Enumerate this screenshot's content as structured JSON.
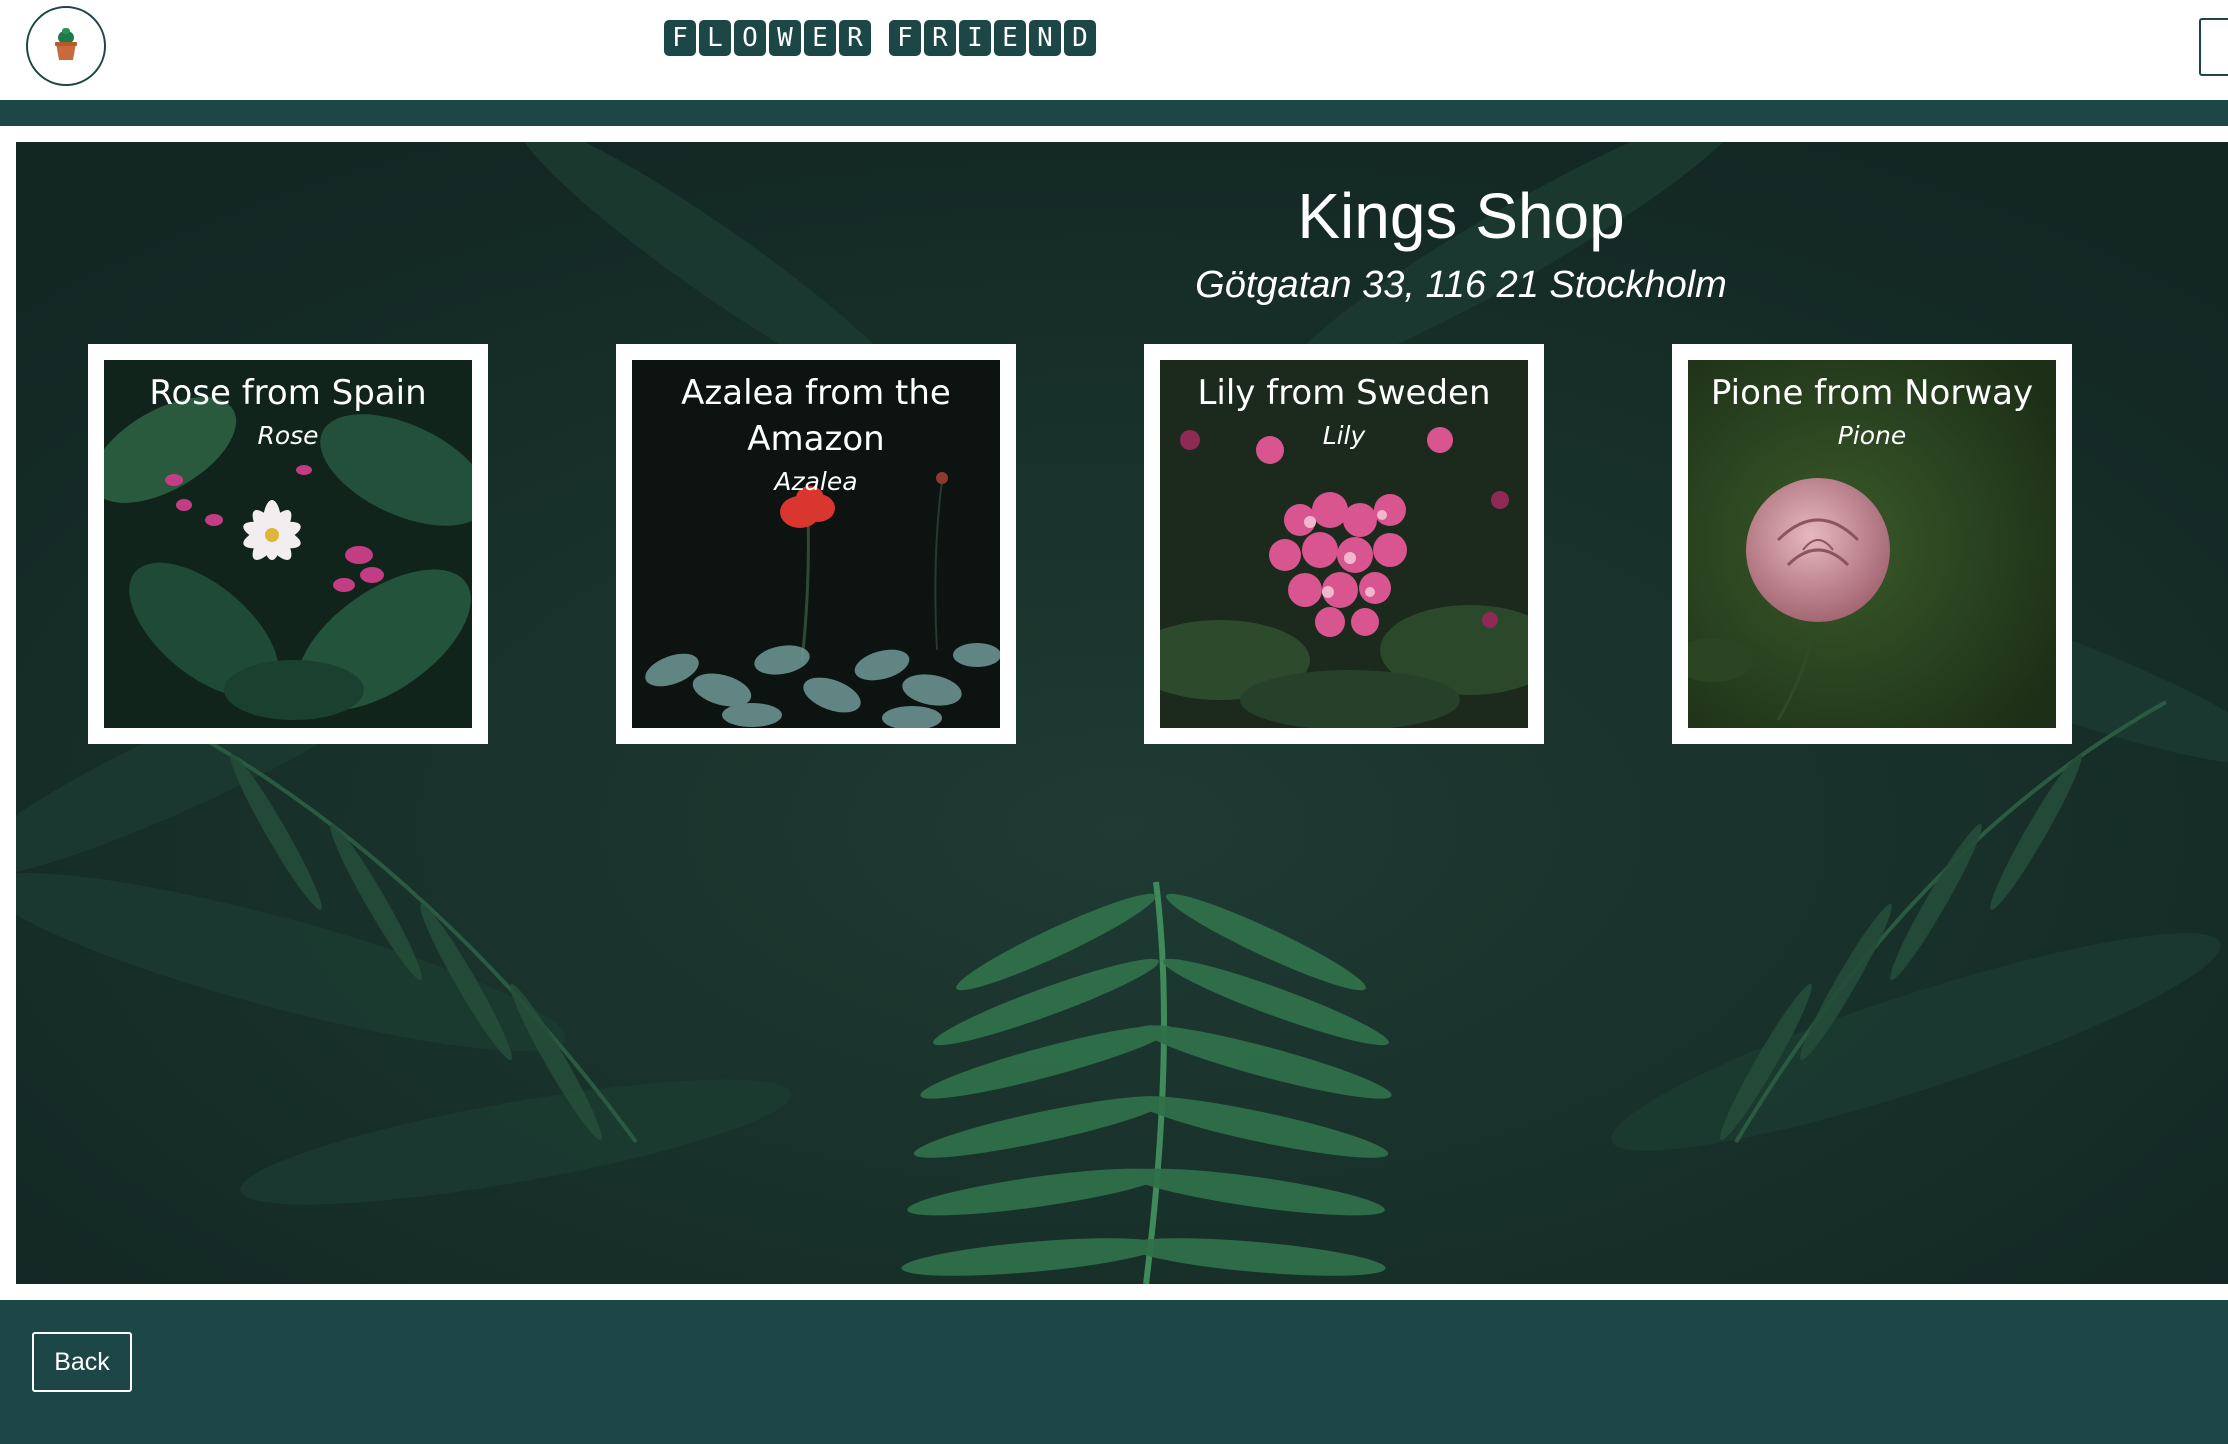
{
  "header": {
    "logo_icon": "cactus-pot-icon",
    "brand_words": [
      [
        "F",
        "L",
        "O",
        "W",
        "E",
        "R"
      ],
      [
        "F",
        "R",
        "I",
        "E",
        "N",
        "D"
      ]
    ],
    "colors": {
      "brand": "#1d4647",
      "background": "#ffffff"
    }
  },
  "shop": {
    "title": "Kings Shop",
    "address": "Götgatan 33, 116 21 Stockholm"
  },
  "flowers": [
    {
      "name": "Rose from Spain",
      "type": "Rose",
      "photo": "white-flower-dark-leaves"
    },
    {
      "name": "Azalea from the Amazon",
      "type": "Azalea",
      "photo": "red-flower-dark"
    },
    {
      "name": "Lily from Sweden",
      "type": "Lily",
      "photo": "pink-blossom-cluster"
    },
    {
      "name": "Pione from Norway",
      "type": "Pione",
      "photo": "pink-rose-green"
    }
  ],
  "footer": {
    "back_label": "Back"
  }
}
